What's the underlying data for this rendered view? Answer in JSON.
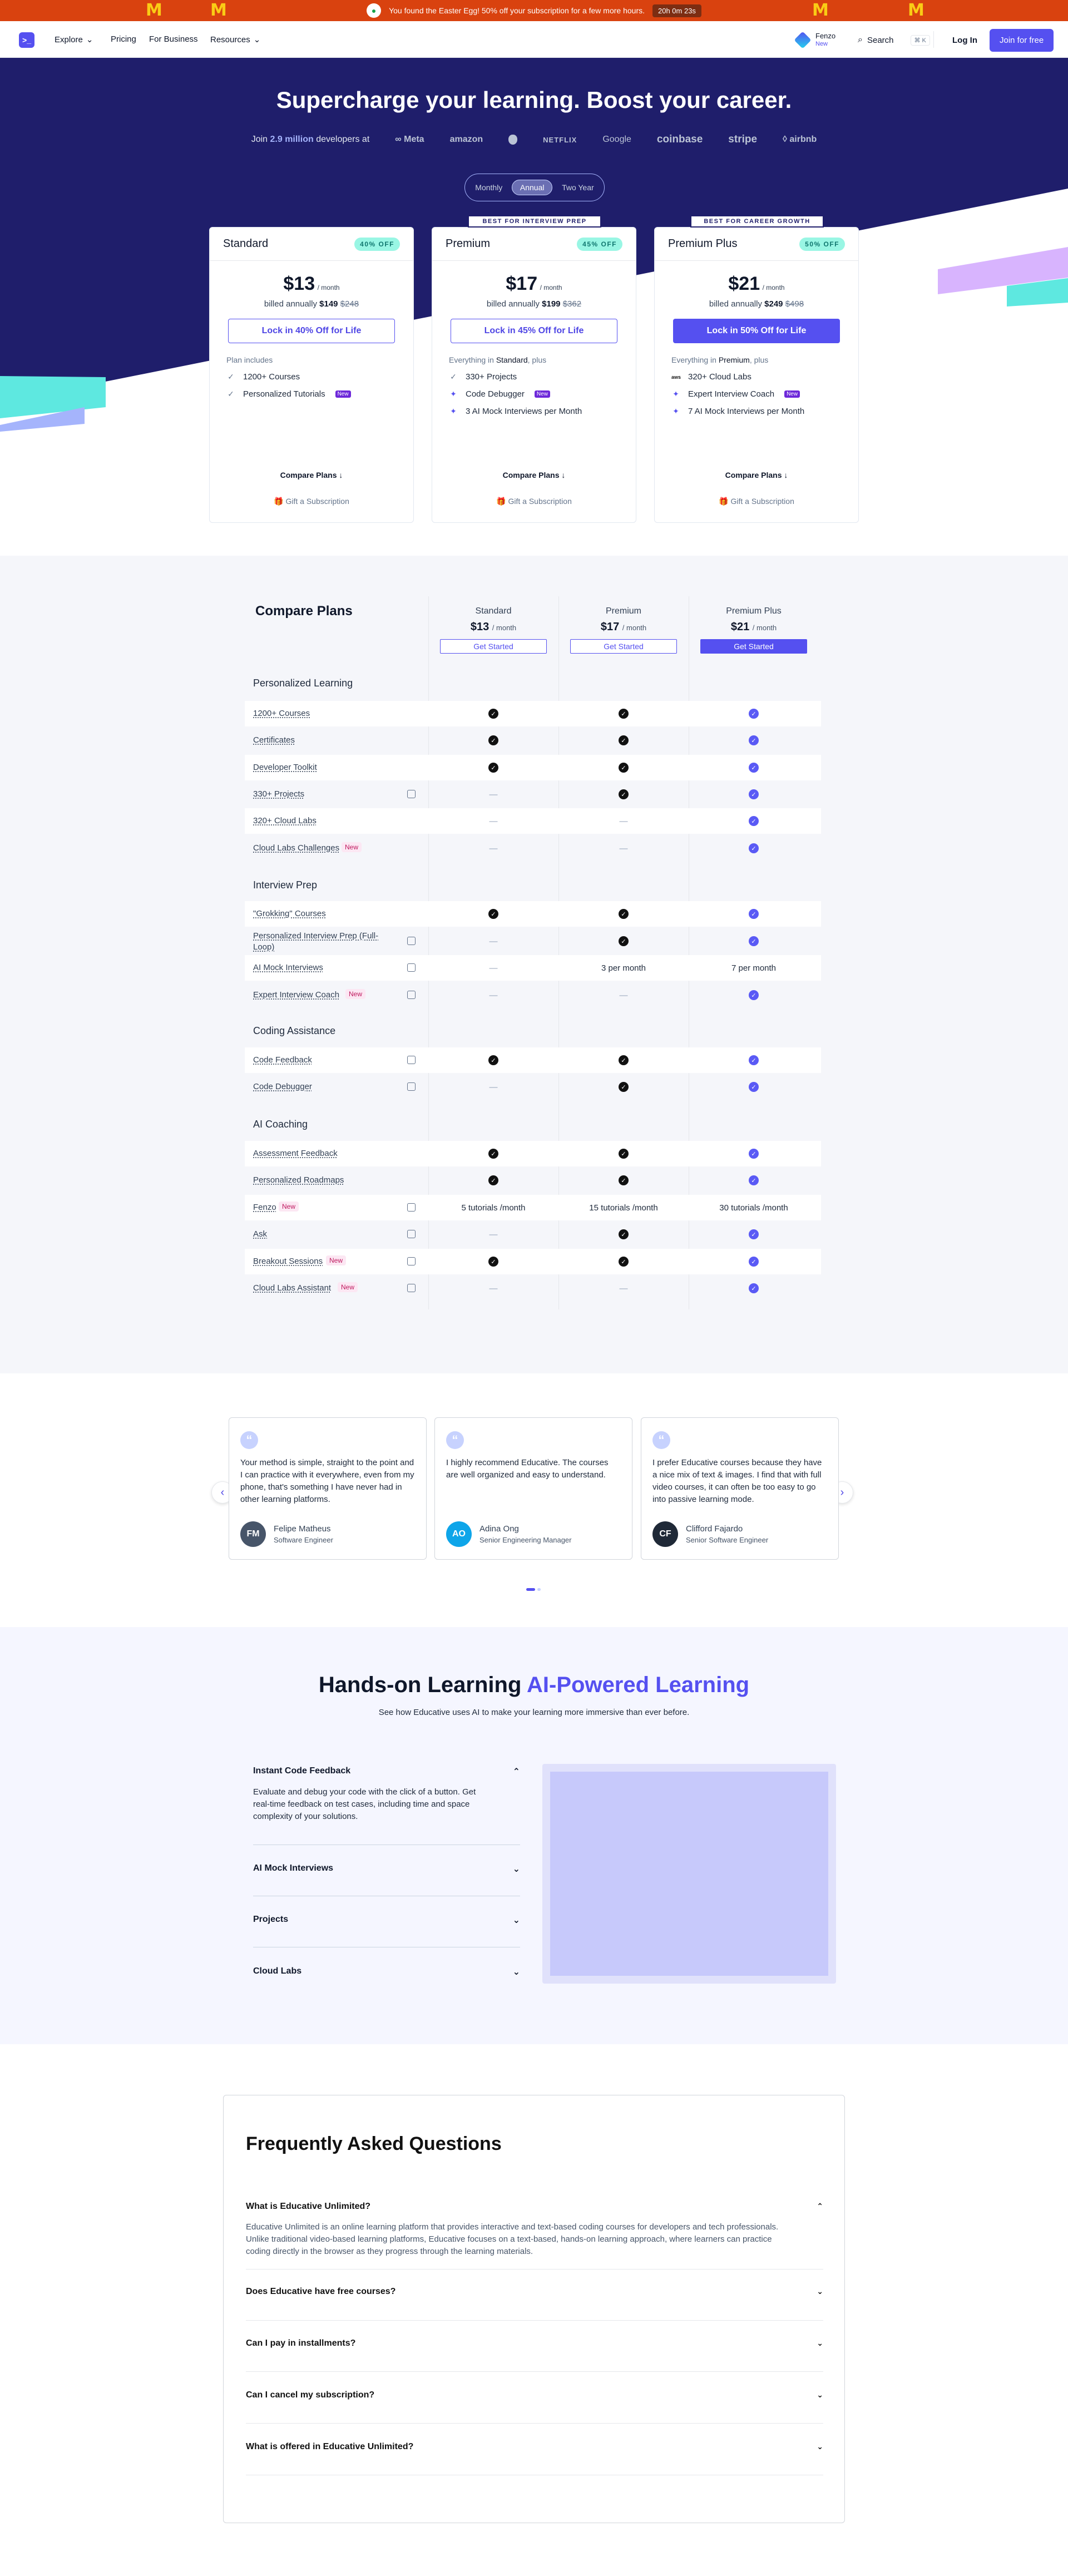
{
  "promo": {
    "text": "You found the Easter Egg! 50% off your subscription for a few more hours.",
    "timer": "20h 0m 23s",
    "arch_glyph": "M"
  },
  "nav": {
    "logo_glyph": ">_",
    "items": [
      "Explore",
      "Pricing",
      "For Business",
      "Resources"
    ],
    "fenzo_name": "Fenzo",
    "fenzo_badge": "New",
    "search": "Search",
    "search_shortcut": "⌘ K",
    "login": "Log In",
    "join": "Join for free"
  },
  "hero": {
    "title": "Supercharge your learning. Boost your career.",
    "join_prefix": "Join",
    "join_count": "2.9 million",
    "join_suffix": "developers at",
    "brands": [
      "Meta",
      "amazon",
      "",
      "NETFLIX",
      "Google",
      "coinbase",
      "stripe",
      "airbnb"
    ],
    "toggle": [
      "Monthly",
      "Annual",
      "Two Year"
    ]
  },
  "plans": [
    {
      "ribbon": "",
      "name": "Standard",
      "off": "40% OFF",
      "price": "$13",
      "per": "/ month",
      "billed_prefix": "billed annually",
      "billed_now": "$149",
      "billed_was": "$248",
      "cta": "Lock in 40% Off for Life",
      "includes_prefix": "Plan includes",
      "includes_plan": "",
      "includes_suffix": "",
      "features": [
        {
          "icon": "check-icon",
          "label": "1200+ Courses",
          "badge": ""
        },
        {
          "icon": "check-icon",
          "label": "Personalized Tutorials",
          "badge": "New"
        }
      ],
      "compare": "Compare Plans ↓",
      "gift": "Gift a Subscription"
    },
    {
      "ribbon": "BEST FOR INTERVIEW PREP",
      "name": "Premium",
      "off": "45% OFF",
      "price": "$17",
      "per": "/ month",
      "billed_prefix": "billed annually",
      "billed_now": "$199",
      "billed_was": "$362",
      "cta": "Lock in 45% Off for Life",
      "includes_prefix": "Everything in",
      "includes_plan": "Standard",
      "includes_suffix": ", plus",
      "features": [
        {
          "icon": "check-icon",
          "label": "330+ Projects",
          "badge": ""
        },
        {
          "icon": "sparkle-icon",
          "label": "Code Debugger",
          "badge": "New"
        },
        {
          "icon": "sparkle-icon",
          "label": "3 AI Mock Interviews per Month",
          "badge": ""
        }
      ],
      "compare": "Compare Plans ↓",
      "gift": "Gift a Subscription"
    },
    {
      "ribbon": "BEST FOR CAREER GROWTH",
      "name": "Premium Plus",
      "off": "50% OFF",
      "price": "$21",
      "per": "/ month",
      "billed_prefix": "billed annually",
      "billed_now": "$249",
      "billed_was": "$498",
      "cta": "Lock in 50% Off for Life",
      "includes_prefix": "Everything in",
      "includes_plan": "Premium",
      "includes_suffix": ", plus",
      "features": [
        {
          "icon": "aws-icon",
          "label": "320+ Cloud Labs",
          "badge": ""
        },
        {
          "icon": "sparkle-icon",
          "label": "Expert Interview Coach",
          "badge": "New"
        },
        {
          "icon": "sparkle-icon",
          "label": "7 AI Mock Interviews per Month",
          "badge": ""
        }
      ],
      "compare": "Compare Plans ↓",
      "gift": "Gift a Subscription"
    }
  ],
  "compare": {
    "title": "Compare Plans",
    "columns": [
      {
        "name": "Standard",
        "price": "$13",
        "per": "/ month",
        "cta": "Get Started"
      },
      {
        "name": "Premium",
        "price": "$17",
        "per": "/ month",
        "cta": "Get Started"
      },
      {
        "name": "Premium Plus",
        "price": "$21",
        "per": "/ month",
        "cta": "Get Started"
      }
    ],
    "sections": [
      {
        "title": "Personalized Learning",
        "rows": [
          {
            "label": "1200+ Courses",
            "badge": "",
            "icon": false,
            "cells": [
              "check",
              "check",
              "check"
            ]
          },
          {
            "label": "Certificates",
            "badge": "",
            "icon": false,
            "cells": [
              "check",
              "check",
              "check"
            ]
          },
          {
            "label": "Developer Toolkit",
            "badge": "",
            "icon": false,
            "cells": [
              "check",
              "check",
              "check"
            ]
          },
          {
            "label": "330+ Projects",
            "badge": "",
            "icon": true,
            "cells": [
              "—",
              "check",
              "check"
            ]
          },
          {
            "label": "320+ Cloud Labs",
            "badge": "",
            "icon": false,
            "cells": [
              "—",
              "—",
              "check"
            ]
          },
          {
            "label": "Cloud Labs Challenges",
            "badge": "New",
            "icon": false,
            "cells": [
              "—",
              "—",
              "check"
            ]
          }
        ]
      },
      {
        "title": "Interview Prep",
        "rows": [
          {
            "label": "\"Grokking\" Courses",
            "badge": "",
            "icon": false,
            "cells": [
              "check",
              "check",
              "check"
            ]
          },
          {
            "label": "Personalized Interview Prep (Full-Loop)",
            "badge": "",
            "icon": true,
            "cells": [
              "—",
              "check",
              "check"
            ]
          },
          {
            "label": "AI Mock Interviews",
            "badge": "",
            "icon": true,
            "cells": [
              "—",
              "3 per month",
              "7 per month"
            ]
          },
          {
            "label": "Expert Interview Coach",
            "badge": "New",
            "icon": true,
            "cells": [
              "—",
              "—",
              "check"
            ]
          }
        ]
      },
      {
        "title": "Coding Assistance",
        "rows": [
          {
            "label": "Code Feedback",
            "badge": "",
            "icon": true,
            "cells": [
              "check",
              "check",
              "check"
            ]
          },
          {
            "label": "Code Debugger",
            "badge": "",
            "icon": true,
            "cells": [
              "—",
              "check",
              "check"
            ]
          }
        ]
      },
      {
        "title": "AI Coaching",
        "rows": [
          {
            "label": "Assessment Feedback",
            "badge": "",
            "icon": false,
            "cells": [
              "check",
              "check",
              "check"
            ]
          },
          {
            "label": "Personalized Roadmaps",
            "badge": "",
            "icon": false,
            "cells": [
              "check",
              "check",
              "check"
            ]
          },
          {
            "label": "Fenzo",
            "badge": "New",
            "icon": true,
            "cells": [
              "5 tutorials /month",
              "15 tutorials /month",
              "30 tutorials /month"
            ]
          },
          {
            "label": "Ask",
            "badge": "",
            "icon": true,
            "cells": [
              "—",
              "check",
              "check"
            ]
          },
          {
            "label": "Breakout Sessions",
            "badge": "New",
            "icon": true,
            "cells": [
              "check",
              "check",
              "check"
            ]
          },
          {
            "label": "Cloud Labs Assistant",
            "badge": "New",
            "icon": true,
            "cells": [
              "—",
              "—",
              "check"
            ]
          }
        ]
      }
    ]
  },
  "testimonials": [
    {
      "text": "Your method is simple, straight to the point and I can practice with it everywhere, even from my phone, that's something I have never had in other learning platforms.",
      "name": "Felipe Matheus",
      "role": "Software Engineer",
      "initials": "FM",
      "avatar_color": "#475569"
    },
    {
      "text": "I highly recommend Educative. The courses are well organized and easy to understand.",
      "name": "Adina Ong",
      "role": "Senior Engineering Manager",
      "initials": "AO",
      "avatar_color": "#0ea5e9"
    },
    {
      "text": "I prefer Educative courses because they have a nice mix of text & images. I find that with full video courses, it can often be too easy to go into passive learning mode.",
      "name": "Clifford Fajardo",
      "role": "Senior Software Engineer",
      "initials": "CF",
      "avatar_color": "#1f2937"
    }
  ],
  "handson": {
    "title_plain": "Hands-on Learning",
    "title_ai": "AI-Powered Learning",
    "subtitle": "See how Educative uses AI to make your learning more immersive than ever before.",
    "items": [
      {
        "title": "Instant Code Feedback",
        "body": "Evaluate and debug your code with the click of a button. Get real-time feedback on test cases, including time and space complexity of your solutions.",
        "open": true
      },
      {
        "title": "AI Mock Interviews",
        "body": "",
        "open": false
      },
      {
        "title": "Projects",
        "body": "",
        "open": false
      },
      {
        "title": "Cloud Labs",
        "body": "",
        "open": false
      }
    ]
  },
  "faq": {
    "title": "Frequently Asked Questions",
    "items": [
      {
        "q": "What is Educative Unlimited?",
        "a": "Educative Unlimited is an online learning platform that provides interactive and text-based coding courses for developers and tech professionals. Unlike traditional video-based learning platforms, Educative focuses on a text-based, hands-on learning approach, where learners can practice coding directly in the browser as they progress through the learning materials.",
        "open": true
      },
      {
        "q": "Does Educative have free courses?",
        "a": "",
        "open": false
      },
      {
        "q": "Can I pay in installments?",
        "a": "",
        "open": false
      },
      {
        "q": "Can I cancel my subscription?",
        "a": "",
        "open": false
      },
      {
        "q": "What is offered in Educative Unlimited?",
        "a": "",
        "open": false
      }
    ]
  },
  "colors": {
    "accent": "#5550f0",
    "hero_bg": "#1f1e6b",
    "promo_bg": "#d9420f",
    "teal": "#5ee8e0",
    "lavender": "#c4b5fd"
  }
}
